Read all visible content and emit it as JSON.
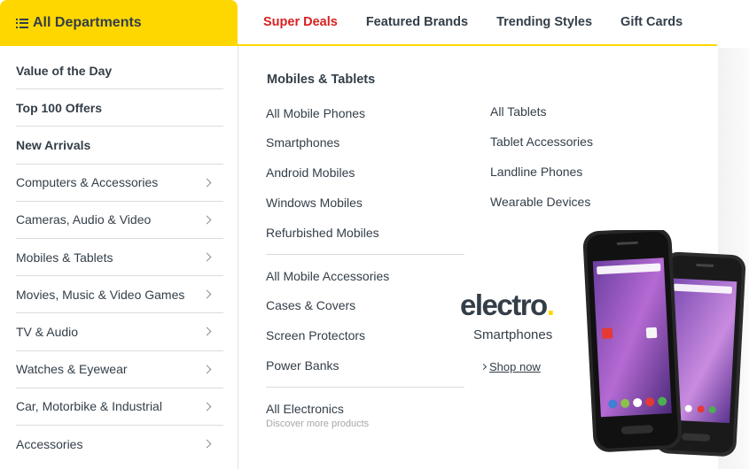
{
  "departments_button": {
    "label": "All Departments",
    "icon": "list-icon"
  },
  "top_nav": {
    "items": [
      {
        "label": "Super Deals",
        "color": "#d72121"
      },
      {
        "label": "Featured Brands"
      },
      {
        "label": "Trending Styles"
      },
      {
        "label": "Gift Cards"
      }
    ]
  },
  "sidebar": {
    "items": [
      {
        "label": "Value of the Day"
      },
      {
        "label": "Top 100 Offers"
      },
      {
        "label": "New Arrivals"
      },
      {
        "label": "Computers & Accessories"
      },
      {
        "label": "Cameras, Audio & Video"
      },
      {
        "label": "Mobiles & Tablets"
      },
      {
        "label": "Movies, Music & Video Games"
      },
      {
        "label": "TV & Audio"
      },
      {
        "label": "Watches & Eyewear"
      },
      {
        "label": "Car, Motorbike & Industrial"
      },
      {
        "label": "Accessories"
      }
    ]
  },
  "mega_menu": {
    "title": "Mobiles & Tablets",
    "left_group_1": [
      "All Mobile Phones",
      "Smartphones",
      "Android Mobiles",
      "Windows Mobiles",
      "Refurbished Mobiles"
    ],
    "left_group_2": [
      "All Mobile Accessories",
      "Cases & Covers",
      "Screen Protectors",
      "Power Banks"
    ],
    "left_group_3": {
      "label": "All Electronics",
      "sub": "Discover more products"
    },
    "right_group": [
      "All Tablets",
      "Tablet Accessories",
      "Landline Phones",
      "Wearable Devices"
    ]
  },
  "promo": {
    "brand": "electro",
    "brand_dot": ".",
    "subtitle": "Smartphones",
    "cta": "Shop now"
  },
  "colors": {
    "accent": "#fed700",
    "text": "#333e48",
    "deal": "#d72121"
  }
}
